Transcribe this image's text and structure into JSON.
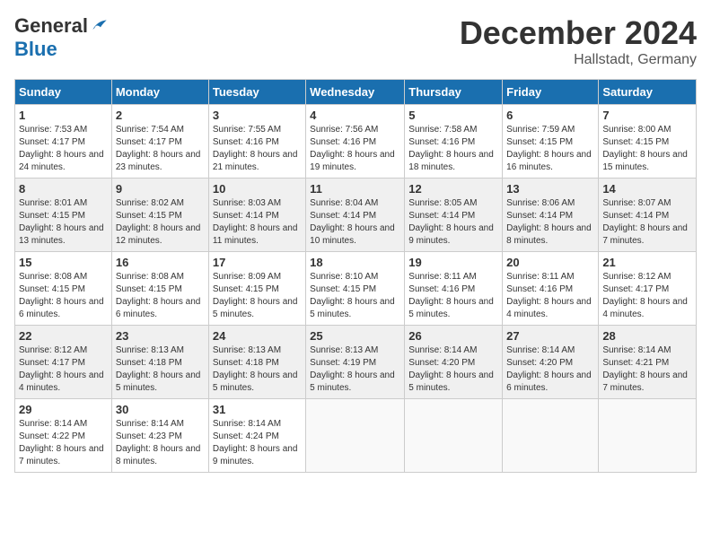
{
  "header": {
    "logo_general": "General",
    "logo_blue": "Blue",
    "month": "December 2024",
    "location": "Hallstadt, Germany"
  },
  "weekdays": [
    "Sunday",
    "Monday",
    "Tuesday",
    "Wednesday",
    "Thursday",
    "Friday",
    "Saturday"
  ],
  "weeks": [
    [
      {
        "day": "1",
        "sunrise": "7:53 AM",
        "sunset": "4:17 PM",
        "daylight": "8 hours and 24 minutes."
      },
      {
        "day": "2",
        "sunrise": "7:54 AM",
        "sunset": "4:17 PM",
        "daylight": "8 hours and 23 minutes."
      },
      {
        "day": "3",
        "sunrise": "7:55 AM",
        "sunset": "4:16 PM",
        "daylight": "8 hours and 21 minutes."
      },
      {
        "day": "4",
        "sunrise": "7:56 AM",
        "sunset": "4:16 PM",
        "daylight": "8 hours and 19 minutes."
      },
      {
        "day": "5",
        "sunrise": "7:58 AM",
        "sunset": "4:16 PM",
        "daylight": "8 hours and 18 minutes."
      },
      {
        "day": "6",
        "sunrise": "7:59 AM",
        "sunset": "4:15 PM",
        "daylight": "8 hours and 16 minutes."
      },
      {
        "day": "7",
        "sunrise": "8:00 AM",
        "sunset": "4:15 PM",
        "daylight": "8 hours and 15 minutes."
      }
    ],
    [
      {
        "day": "8",
        "sunrise": "8:01 AM",
        "sunset": "4:15 PM",
        "daylight": "8 hours and 13 minutes."
      },
      {
        "day": "9",
        "sunrise": "8:02 AM",
        "sunset": "4:15 PM",
        "daylight": "8 hours and 12 minutes."
      },
      {
        "day": "10",
        "sunrise": "8:03 AM",
        "sunset": "4:14 PM",
        "daylight": "8 hours and 11 minutes."
      },
      {
        "day": "11",
        "sunrise": "8:04 AM",
        "sunset": "4:14 PM",
        "daylight": "8 hours and 10 minutes."
      },
      {
        "day": "12",
        "sunrise": "8:05 AM",
        "sunset": "4:14 PM",
        "daylight": "8 hours and 9 minutes."
      },
      {
        "day": "13",
        "sunrise": "8:06 AM",
        "sunset": "4:14 PM",
        "daylight": "8 hours and 8 minutes."
      },
      {
        "day": "14",
        "sunrise": "8:07 AM",
        "sunset": "4:14 PM",
        "daylight": "8 hours and 7 minutes."
      }
    ],
    [
      {
        "day": "15",
        "sunrise": "8:08 AM",
        "sunset": "4:15 PM",
        "daylight": "8 hours and 6 minutes."
      },
      {
        "day": "16",
        "sunrise": "8:08 AM",
        "sunset": "4:15 PM",
        "daylight": "8 hours and 6 minutes."
      },
      {
        "day": "17",
        "sunrise": "8:09 AM",
        "sunset": "4:15 PM",
        "daylight": "8 hours and 5 minutes."
      },
      {
        "day": "18",
        "sunrise": "8:10 AM",
        "sunset": "4:15 PM",
        "daylight": "8 hours and 5 minutes."
      },
      {
        "day": "19",
        "sunrise": "8:11 AM",
        "sunset": "4:16 PM",
        "daylight": "8 hours and 5 minutes."
      },
      {
        "day": "20",
        "sunrise": "8:11 AM",
        "sunset": "4:16 PM",
        "daylight": "8 hours and 4 minutes."
      },
      {
        "day": "21",
        "sunrise": "8:12 AM",
        "sunset": "4:17 PM",
        "daylight": "8 hours and 4 minutes."
      }
    ],
    [
      {
        "day": "22",
        "sunrise": "8:12 AM",
        "sunset": "4:17 PM",
        "daylight": "8 hours and 4 minutes."
      },
      {
        "day": "23",
        "sunrise": "8:13 AM",
        "sunset": "4:18 PM",
        "daylight": "8 hours and 5 minutes."
      },
      {
        "day": "24",
        "sunrise": "8:13 AM",
        "sunset": "4:18 PM",
        "daylight": "8 hours and 5 minutes."
      },
      {
        "day": "25",
        "sunrise": "8:13 AM",
        "sunset": "4:19 PM",
        "daylight": "8 hours and 5 minutes."
      },
      {
        "day": "26",
        "sunrise": "8:14 AM",
        "sunset": "4:20 PM",
        "daylight": "8 hours and 5 minutes."
      },
      {
        "day": "27",
        "sunrise": "8:14 AM",
        "sunset": "4:20 PM",
        "daylight": "8 hours and 6 minutes."
      },
      {
        "day": "28",
        "sunrise": "8:14 AM",
        "sunset": "4:21 PM",
        "daylight": "8 hours and 7 minutes."
      }
    ],
    [
      {
        "day": "29",
        "sunrise": "8:14 AM",
        "sunset": "4:22 PM",
        "daylight": "8 hours and 7 minutes."
      },
      {
        "day": "30",
        "sunrise": "8:14 AM",
        "sunset": "4:23 PM",
        "daylight": "8 hours and 8 minutes."
      },
      {
        "day": "31",
        "sunrise": "8:14 AM",
        "sunset": "4:24 PM",
        "daylight": "8 hours and 9 minutes."
      },
      null,
      null,
      null,
      null
    ]
  ]
}
